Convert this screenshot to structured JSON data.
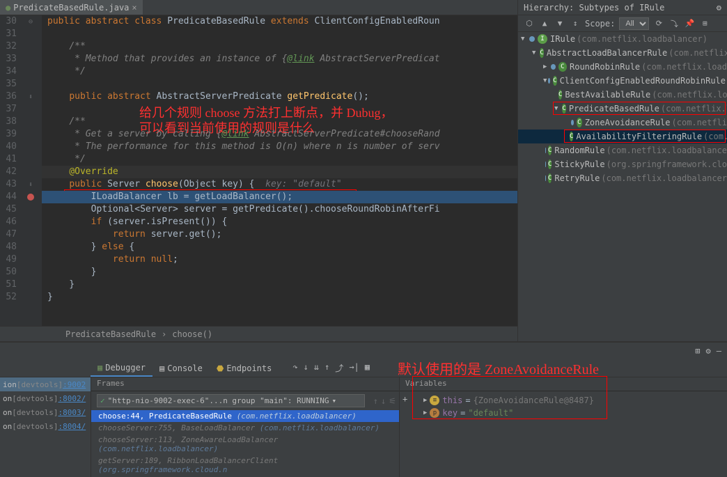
{
  "tab": {
    "filename": "PredicateBasedRule.java"
  },
  "code": {
    "lines": [
      {
        "n": 30,
        "exp": true,
        "html": "<span class='kw'>public abstract class</span> <span class='type'>PredicateBasedRule</span> <span class='kw'>extends</span> <span class='type'>ClientConfigEnabledRoun</span>"
      },
      {
        "n": 31,
        "html": ""
      },
      {
        "n": 32,
        "html": "    <span class='cm'>/**</span>"
      },
      {
        "n": 33,
        "html": "    <span class='cm'> * Method that provides an instance of {</span><span class='cm-link'>@link</span><span class='cm'> AbstractServerPredicat</span>"
      },
      {
        "n": 34,
        "html": "    <span class='cm'> */</span>"
      },
      {
        "n": 35,
        "html": "    "
      },
      {
        "n": 36,
        "ovrd": true,
        "html": "    <span class='kw'>public abstract</span> <span class='type'>AbstractServerPredicate</span> <span class='fn'>getPredicate</span>();"
      },
      {
        "n": 37,
        "html": ""
      },
      {
        "n": 38,
        "html": "    <span class='cm'>/**</span>"
      },
      {
        "n": 39,
        "html": "    <span class='cm'> * Get a server by calling {</span><span class='cm-link'>@link</span><span class='cm'> AbstractServerPredicate#chooseRand</span>"
      },
      {
        "n": 40,
        "html": "    <span class='cm'> * The performance for this method is O(n) where n is number of serv</span>"
      },
      {
        "n": 41,
        "html": "    <span class='cm'> */</span>"
      },
      {
        "n": 42,
        "cursor": true,
        "html": "    <span class='anno'>@Override</span>"
      },
      {
        "n": 43,
        "ovrd": true,
        "html": "    <span class='kw'>public</span> <span class='type'>Server</span> <span class='fn'>choose</span>(<span class='type'>Object</span> key) {  <span class='param'>key: \"default\"</span>"
      },
      {
        "n": 44,
        "bp": true,
        "exec": true,
        "bulb": true,
        "html": "        <span class='type'>ILoadBalancer</span> lb = getLoadBalancer();"
      },
      {
        "n": 45,
        "html": "        <span class='type'>Optional</span>&lt;<span class='type'>Server</span>&gt; server = getPredicate().chooseRoundRobinAfterFi"
      },
      {
        "n": 46,
        "html": "        <span class='kw'>if</span> (server.isPresent()) {"
      },
      {
        "n": 47,
        "html": "            <span class='kw'>return</span> server.get();"
      },
      {
        "n": 48,
        "html": "        } <span class='kw'>else</span> {"
      },
      {
        "n": 49,
        "html": "            <span class='kw'>return null</span>;"
      },
      {
        "n": 50,
        "html": "        }"
      },
      {
        "n": 51,
        "html": "    }"
      },
      {
        "n": 52,
        "html": "}"
      }
    ],
    "annotation1": "给几个规则 choose 方法打上断点，并 Dubug，",
    "annotation2": "可以看到当前使用的规则是什么"
  },
  "breadcrumb": {
    "class": "PredicateBasedRule",
    "method": "choose()"
  },
  "hierarchy": {
    "title": "Hierarchy: Subtypes of IRule",
    "scope_label": "Scope:",
    "scope_value": "All",
    "tree": [
      {
        "indent": 0,
        "exp": "▼",
        "icon": "I",
        "label": "IRule",
        "pkg": "(com.netflix.loadbalancer)"
      },
      {
        "indent": 1,
        "exp": "▼",
        "icon": "C",
        "label": "AbstractLoadBalancerRule",
        "pkg": "(com.netflix.lo"
      },
      {
        "indent": 2,
        "exp": "▶",
        "icon": "C",
        "label": "RoundRobinRule",
        "pkg": "(com.netflix.load"
      },
      {
        "indent": 2,
        "exp": "▼",
        "icon": "C",
        "label": "ClientConfigEnabledRoundRobinRule",
        "pkg": ""
      },
      {
        "indent": 3,
        "exp": "",
        "icon": "C",
        "label": "BestAvailableRule",
        "pkg": "(com.netflix.loa"
      },
      {
        "indent": 3,
        "exp": "▼",
        "icon": "C",
        "label": "PredicateBasedRule",
        "pkg": "(com.netflix.lo",
        "box": true
      },
      {
        "indent": 4,
        "exp": "",
        "icon": "C",
        "label": "ZoneAvoidanceRule",
        "pkg": "(com.netfli"
      },
      {
        "indent": 4,
        "exp": "",
        "icon": "C",
        "label": "AvailabilityFilteringRule",
        "pkg": "(com.n",
        "sel": true,
        "box": true
      },
      {
        "indent": 2,
        "exp": "",
        "icon": "C",
        "label": "RandomRule",
        "pkg": "(com.netflix.loadbalance"
      },
      {
        "indent": 2,
        "exp": "",
        "icon": "C",
        "label": "StickyRule",
        "pkg": "(org.springframework.clo"
      },
      {
        "indent": 2,
        "exp": "",
        "icon": "C",
        "label": "RetryRule",
        "pkg": "(com.netflix.loadbalancer"
      }
    ]
  },
  "debugger": {
    "tabs": {
      "debugger": "Debugger",
      "console": "Console",
      "endpoints": "Endpoints"
    },
    "annotation": "默认使用的是 ZoneAvoidanceRule",
    "left_items": [
      {
        "label": "ion",
        "suffix": "[devtools]",
        "port": ":9002",
        "hi": true
      },
      {
        "label": "on",
        "suffix": "[devtools]",
        "port": ":8002/"
      },
      {
        "label": "on",
        "suffix": "[devtools]",
        "port": ":8003/"
      },
      {
        "label": "on",
        "suffix": "[devtools]",
        "port": ":8004/"
      }
    ],
    "frames": {
      "title": "Frames",
      "thread": "\"http-nio-9002-exec-6\"...n group \"main\": RUNNING",
      "items": [
        {
          "text": "choose:44, PredicateBasedRule",
          "pkg": "(com.netflix.loadbalancer)",
          "sel": true
        },
        {
          "text": "chooseServer:755, BaseLoadBalancer",
          "pkg": "(com.netflix.loadbalancer)"
        },
        {
          "text": "chooseServer:113, ZoneAwareLoadBalancer",
          "pkg": "(com.netflix.loadbalancer)"
        },
        {
          "text": "getServer:189, RibbonLoadBalancerClient",
          "pkg": "(org.springframework.cloud.n"
        }
      ]
    },
    "variables": {
      "title": "Variables",
      "items": [
        {
          "icon": "obj",
          "name": "this",
          "eq": " = ",
          "val": "{ZoneAvoidanceRule@8487}"
        },
        {
          "icon": "p",
          "name": "key",
          "eq": " = ",
          "str": "\"default\""
        }
      ]
    }
  }
}
